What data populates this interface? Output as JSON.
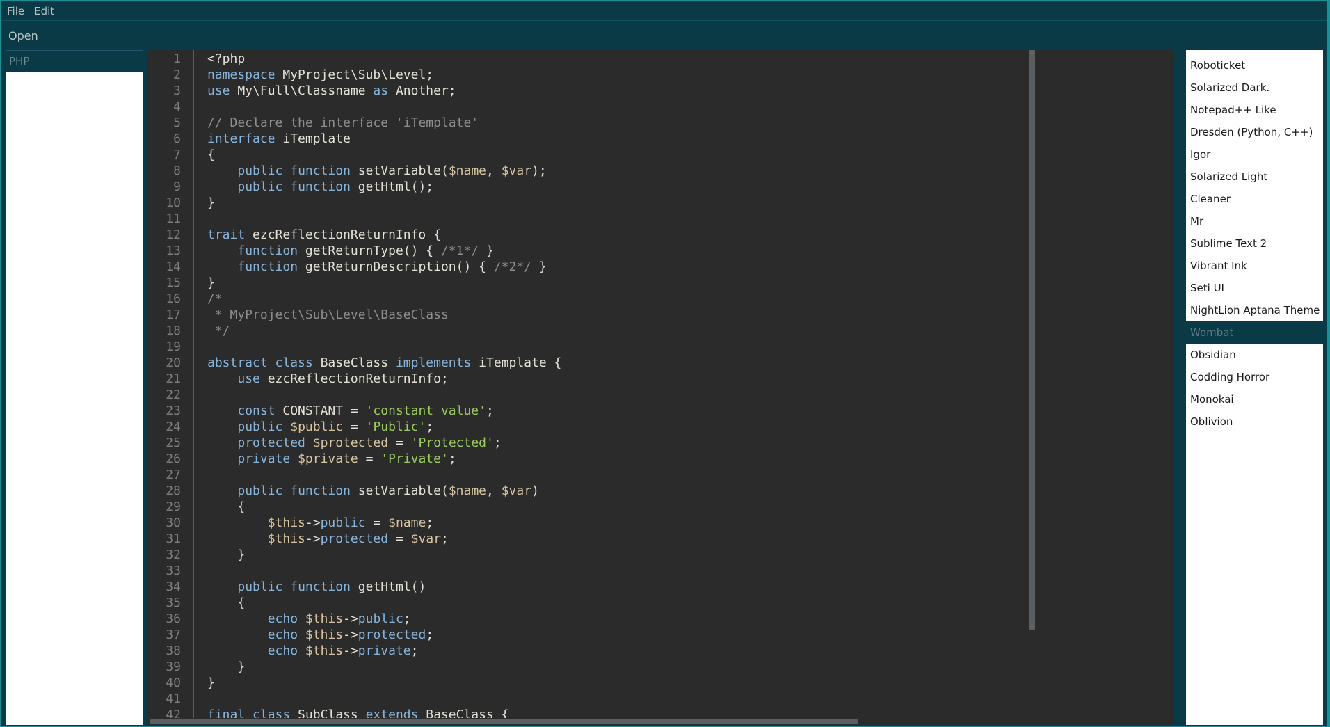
{
  "menubar": {
    "file": "File",
    "edit": "Edit"
  },
  "toolbar": {
    "open": "Open"
  },
  "language": {
    "selected": "PHP"
  },
  "themes": {
    "items": [
      "Roboticket",
      "Solarized Dark.",
      "Notepad++ Like",
      "Dresden (Python, C++)",
      "Igor",
      "Solarized Light",
      "Cleaner",
      "Mr",
      "Sublime Text 2",
      "Vibrant Ink",
      "Seti UI",
      "NightLion Aptana Theme",
      "Wombat",
      "Obsidian",
      "Codding Horror",
      "Monokai",
      "Oblivion"
    ],
    "selected": "Wombat"
  },
  "editor": {
    "lines": [
      [
        [
          "p",
          "<?php"
        ]
      ],
      [
        [
          "k",
          "namespace"
        ],
        [
          "p",
          " MyProject\\Sub\\Level;"
        ]
      ],
      [
        [
          "k",
          "use"
        ],
        [
          "p",
          " My\\Full\\Classname "
        ],
        [
          "k",
          "as"
        ],
        [
          "p",
          " Another;"
        ]
      ],
      [],
      [
        [
          "c",
          "// Declare the interface 'iTemplate'"
        ]
      ],
      [
        [
          "k",
          "interface"
        ],
        [
          "p",
          " iTemplate"
        ]
      ],
      [
        [
          "p",
          "{"
        ]
      ],
      [
        [
          "p",
          "    "
        ],
        [
          "k",
          "public"
        ],
        [
          "p",
          " "
        ],
        [
          "k",
          "function"
        ],
        [
          "p",
          " setVariable("
        ],
        [
          "v",
          "$name"
        ],
        [
          "p",
          ", "
        ],
        [
          "v",
          "$var"
        ],
        [
          "p",
          ");"
        ]
      ],
      [
        [
          "p",
          "    "
        ],
        [
          "k",
          "public"
        ],
        [
          "p",
          " "
        ],
        [
          "k",
          "function"
        ],
        [
          "p",
          " getHtml();"
        ]
      ],
      [
        [
          "p",
          "}"
        ]
      ],
      [],
      [
        [
          "k",
          "trait"
        ],
        [
          "p",
          " ezcReflectionReturnInfo {"
        ]
      ],
      [
        [
          "p",
          "    "
        ],
        [
          "k",
          "function"
        ],
        [
          "p",
          " getReturnType() { "
        ],
        [
          "c",
          "/*1*/"
        ],
        [
          "p",
          " }"
        ]
      ],
      [
        [
          "p",
          "    "
        ],
        [
          "k",
          "function"
        ],
        [
          "p",
          " getReturnDescription() { "
        ],
        [
          "c",
          "/*2*/"
        ],
        [
          "p",
          " }"
        ]
      ],
      [
        [
          "p",
          "}"
        ]
      ],
      [
        [
          "c",
          "/*"
        ]
      ],
      [
        [
          "c",
          " * MyProject\\Sub\\Level\\BaseClass"
        ]
      ],
      [
        [
          "c",
          " */"
        ]
      ],
      [],
      [
        [
          "k",
          "abstract"
        ],
        [
          "p",
          " "
        ],
        [
          "k",
          "class"
        ],
        [
          "p",
          " BaseClass "
        ],
        [
          "k",
          "implements"
        ],
        [
          "p",
          " iTemplate {"
        ]
      ],
      [
        [
          "p",
          "    "
        ],
        [
          "k",
          "use"
        ],
        [
          "p",
          " ezcReflectionReturnInfo;"
        ]
      ],
      [],
      [
        [
          "p",
          "    "
        ],
        [
          "k",
          "const"
        ],
        [
          "p",
          " CONSTANT = "
        ],
        [
          "s",
          "'constant value'"
        ],
        [
          "p",
          ";"
        ]
      ],
      [
        [
          "p",
          "    "
        ],
        [
          "k",
          "public"
        ],
        [
          "p",
          " "
        ],
        [
          "v",
          "$public"
        ],
        [
          "p",
          " = "
        ],
        [
          "s",
          "'Public'"
        ],
        [
          "p",
          ";"
        ]
      ],
      [
        [
          "p",
          "    "
        ],
        [
          "k",
          "protected"
        ],
        [
          "p",
          " "
        ],
        [
          "v",
          "$protected"
        ],
        [
          "p",
          " = "
        ],
        [
          "s",
          "'Protected'"
        ],
        [
          "p",
          ";"
        ]
      ],
      [
        [
          "p",
          "    "
        ],
        [
          "k",
          "private"
        ],
        [
          "p",
          " "
        ],
        [
          "v",
          "$private"
        ],
        [
          "p",
          " = "
        ],
        [
          "s",
          "'Private'"
        ],
        [
          "p",
          ";"
        ]
      ],
      [],
      [
        [
          "p",
          "    "
        ],
        [
          "k",
          "public"
        ],
        [
          "p",
          " "
        ],
        [
          "k",
          "function"
        ],
        [
          "p",
          " setVariable("
        ],
        [
          "v",
          "$name"
        ],
        [
          "p",
          ", "
        ],
        [
          "v",
          "$var"
        ],
        [
          "p",
          ")"
        ]
      ],
      [
        [
          "p",
          "    {"
        ]
      ],
      [
        [
          "p",
          "        "
        ],
        [
          "v",
          "$this"
        ],
        [
          "p",
          "->"
        ],
        [
          "k",
          "public"
        ],
        [
          "p",
          " = "
        ],
        [
          "v",
          "$name"
        ],
        [
          "p",
          ";"
        ]
      ],
      [
        [
          "p",
          "        "
        ],
        [
          "v",
          "$this"
        ],
        [
          "p",
          "->"
        ],
        [
          "k",
          "protected"
        ],
        [
          "p",
          " = "
        ],
        [
          "v",
          "$var"
        ],
        [
          "p",
          ";"
        ]
      ],
      [
        [
          "p",
          "    }"
        ]
      ],
      [],
      [
        [
          "p",
          "    "
        ],
        [
          "k",
          "public"
        ],
        [
          "p",
          " "
        ],
        [
          "k",
          "function"
        ],
        [
          "p",
          " getHtml()"
        ]
      ],
      [
        [
          "p",
          "    {"
        ]
      ],
      [
        [
          "p",
          "        "
        ],
        [
          "k",
          "echo"
        ],
        [
          "p",
          " "
        ],
        [
          "v",
          "$this"
        ],
        [
          "p",
          "->"
        ],
        [
          "k",
          "public"
        ],
        [
          "p",
          ";"
        ]
      ],
      [
        [
          "p",
          "        "
        ],
        [
          "k",
          "echo"
        ],
        [
          "p",
          " "
        ],
        [
          "v",
          "$this"
        ],
        [
          "p",
          "->"
        ],
        [
          "k",
          "protected"
        ],
        [
          "p",
          ";"
        ]
      ],
      [
        [
          "p",
          "        "
        ],
        [
          "k",
          "echo"
        ],
        [
          "p",
          " "
        ],
        [
          "v",
          "$this"
        ],
        [
          "p",
          "->"
        ],
        [
          "k",
          "private"
        ],
        [
          "p",
          ";"
        ]
      ],
      [
        [
          "p",
          "    }"
        ]
      ],
      [
        [
          "p",
          "}"
        ]
      ],
      [],
      [
        [
          "k",
          "final"
        ],
        [
          "p",
          " "
        ],
        [
          "k",
          "class"
        ],
        [
          "p",
          " SubClass "
        ],
        [
          "k",
          "extends"
        ],
        [
          "p",
          " BaseClass {"
        ]
      ]
    ]
  }
}
